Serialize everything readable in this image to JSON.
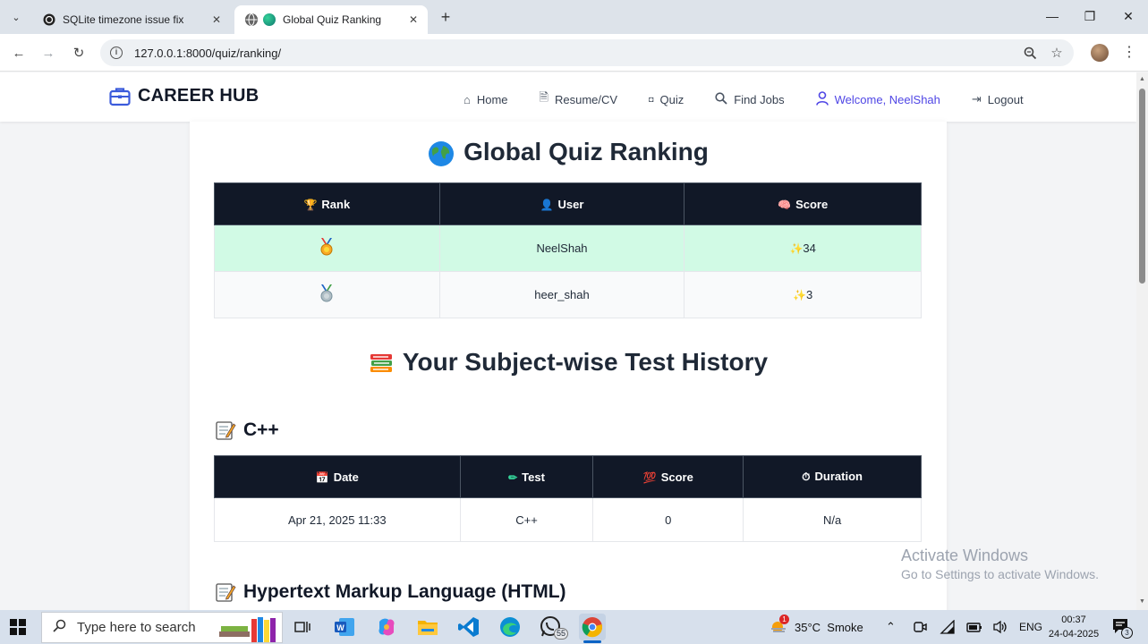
{
  "browser": {
    "tabs": [
      {
        "title": "SQLite timezone issue fix",
        "active": false
      },
      {
        "title": "Global Quiz Ranking",
        "active": true
      }
    ],
    "url": "127.0.0.1:8000/quiz/ranking/"
  },
  "site": {
    "brand": "CAREER HUB",
    "nav": [
      {
        "label": "Home",
        "icon": "home-icon"
      },
      {
        "label": "Resume/CV",
        "icon": "document-icon"
      },
      {
        "label": "Quiz",
        "icon": "quiz-icon"
      },
      {
        "label": "Find Jobs",
        "icon": "search-icon"
      },
      {
        "label": "Welcome, NeelShah",
        "icon": "user-icon"
      },
      {
        "label": "Logout",
        "icon": "logout-icon"
      }
    ]
  },
  "ranking": {
    "title": "Global Quiz Ranking",
    "headers": {
      "rank": "Rank",
      "user": "User",
      "score": "Score"
    },
    "rows": [
      {
        "medal": "gold-medal",
        "user": "NeelShah",
        "score": "34"
      },
      {
        "medal": "silver-medal",
        "user": "heer_shah",
        "score": "3"
      }
    ]
  },
  "history": {
    "title": "Your Subject-wise Test History",
    "subjects": [
      {
        "name": "C++",
        "headers": {
          "date": "Date",
          "test": "Test",
          "score": "Score",
          "duration": "Duration"
        },
        "rows": [
          {
            "date": "Apr 21, 2025 11:33",
            "test": "C++",
            "score": "0",
            "duration": "N/a"
          }
        ]
      },
      {
        "name": "Hypertext Markup Language (HTML)"
      }
    ]
  },
  "watermark": {
    "line1": "Activate Windows",
    "line2": "Go to Settings to activate Windows."
  },
  "taskbar": {
    "search_placeholder": "Type here to search",
    "weather": "35°C  Smoke",
    "weather_badge": "1",
    "whatsapp_badge": "55",
    "language": "ENG",
    "time": "00:37",
    "date": "24-04-2025",
    "notification_count": "3"
  },
  "colors": {
    "nav_dark": "#111827",
    "accent": "#4f46e5",
    "top_row": "#d1fae5"
  }
}
